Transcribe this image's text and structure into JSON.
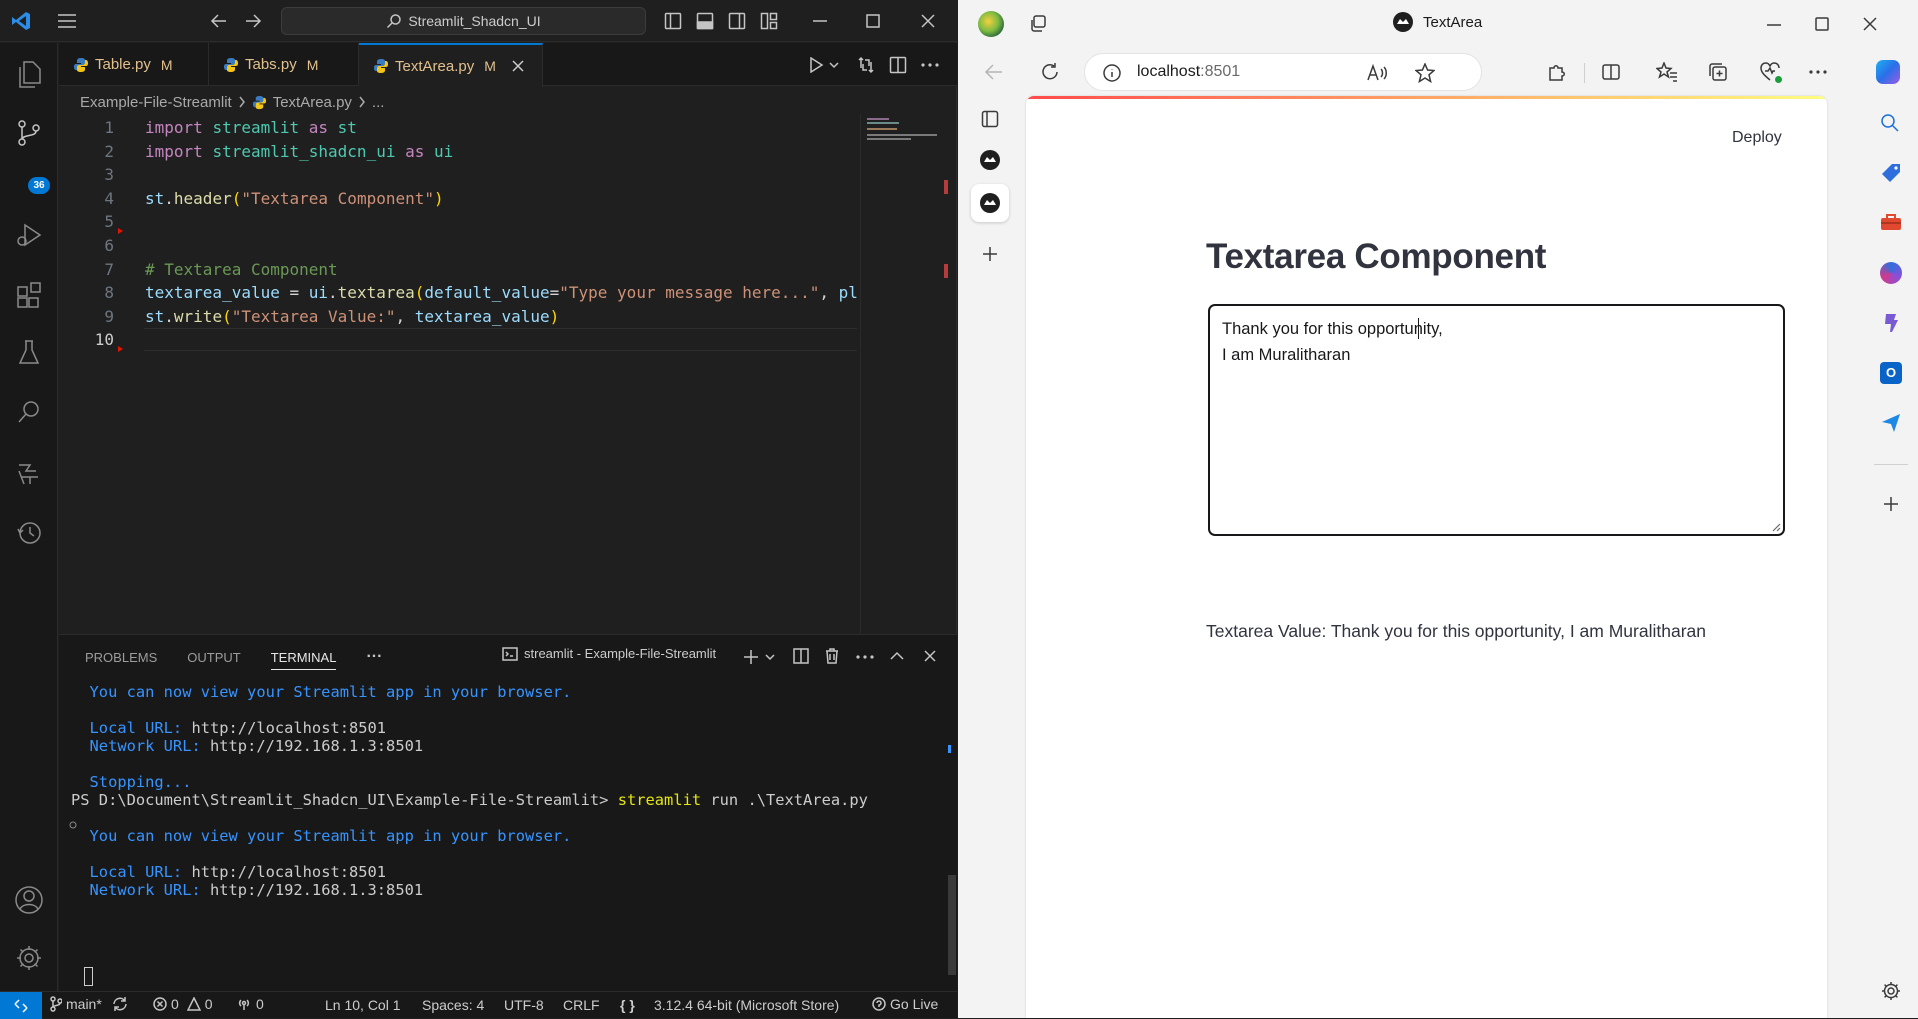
{
  "vscode": {
    "search": "Streamlit_Shadcn_UI",
    "activity": {
      "scm_badge": "36"
    },
    "tabs": [
      {
        "name": "Table.py",
        "status": "M"
      },
      {
        "name": "Tabs.py",
        "status": "M"
      },
      {
        "name": "TextArea.py",
        "status": "M"
      }
    ],
    "breadcrumb": {
      "folder": "Example-File-Streamlit",
      "file": "TextArea.py",
      "more": "..."
    },
    "code_lines": [
      [
        [
          "kw",
          "import "
        ],
        [
          "md",
          "streamlit"
        ],
        [
          "kw",
          " as "
        ],
        [
          "md",
          "st"
        ]
      ],
      [
        [
          "kw",
          "import "
        ],
        [
          "md",
          "streamlit_shadcn_ui"
        ],
        [
          "kw",
          " as "
        ],
        [
          "md",
          "ui"
        ]
      ],
      [],
      [
        [
          "vr",
          "st"
        ],
        [
          "pl",
          "."
        ],
        [
          "fn",
          "header"
        ],
        [
          "bc",
          "("
        ],
        [
          "st",
          "\"Textarea Component\""
        ],
        [
          "bc",
          ")"
        ]
      ],
      [],
      [],
      [
        [
          "cm",
          "# Textarea Component"
        ]
      ],
      [
        [
          "vr",
          "textarea_value"
        ],
        [
          "pl",
          " = "
        ],
        [
          "vr",
          "ui"
        ],
        [
          "pl",
          "."
        ],
        [
          "fn",
          "textarea"
        ],
        [
          "bc",
          "("
        ],
        [
          "vr",
          "default_value"
        ],
        [
          "pl",
          "="
        ],
        [
          "st",
          "\"Type your message here...\""
        ],
        [
          "pl",
          ", "
        ],
        [
          "vr",
          "pl"
        ]
      ],
      [
        [
          "vr",
          "st"
        ],
        [
          "pl",
          "."
        ],
        [
          "fn",
          "write"
        ],
        [
          "bc",
          "("
        ],
        [
          "st",
          "\"Textarea Value:\""
        ],
        [
          "pl",
          ", "
        ],
        [
          "vr",
          "textarea_value"
        ],
        [
          "bc",
          ")"
        ]
      ],
      []
    ],
    "line_numbers": [
      "1",
      "2",
      "3",
      "4",
      "5",
      "6",
      "7",
      "8",
      "9",
      "10"
    ],
    "panel": {
      "tabs": [
        "PROBLEMS",
        "OUTPUT",
        "TERMINAL"
      ],
      "more": "···",
      "terminal_name": "streamlit - Example-File-Streamlit"
    },
    "terminal_lines": [
      [
        [
          "tb",
          "  You can now view your Streamlit app in your browser."
        ]
      ],
      [],
      [
        [
          "tb",
          "  Local URL: "
        ],
        [
          "tw",
          "http://localhost:8501"
        ]
      ],
      [
        [
          "tb",
          "  Network URL: "
        ],
        [
          "tw",
          "http://192.168.1.3:8501"
        ]
      ],
      [],
      [
        [
          "tb",
          "  Stopping..."
        ]
      ],
      [
        [
          "tw",
          "PS D:\\Document\\Streamlit_Shadcn_UI\\Example-File-Streamlit> "
        ],
        [
          "ty",
          "streamlit"
        ],
        [
          "tw",
          " run .\\TextArea.py"
        ]
      ],
      [],
      [
        [
          "tb",
          "  You can now view your Streamlit app in your browser."
        ]
      ],
      [],
      [
        [
          "tb",
          "  Local URL: "
        ],
        [
          "tw",
          "http://localhost:8501"
        ]
      ],
      [
        [
          "tb",
          "  Network URL: "
        ],
        [
          "tw",
          "http://192.168.1.3:8501"
        ]
      ]
    ],
    "statusbar": {
      "branch": "main*",
      "errors": "0",
      "warnings": "0",
      "ports": "0",
      "position": "Ln 10, Col 1",
      "spaces": "Spaces: 4",
      "encoding": "UTF-8",
      "eol": "CRLF",
      "language": "{ }",
      "python": "3.12.4 64-bit (Microsoft Store)",
      "golive": "Go Live"
    }
  },
  "browser": {
    "tab_title": "TextArea",
    "url_host": "localhost",
    "url_port": ":8501",
    "deploy": "Deploy",
    "header": "Textarea Component",
    "textarea_value": "Thank you for this opportunity,\nI am Muralitharan",
    "output": "Textarea Value: Thank you for this opportunity, I am Muralitharan"
  },
  "colors": {
    "accent": "#0078d4",
    "vscode_bg": "#1f1f1f",
    "editor_bg": "#181818",
    "streamlit_red": "#ff4b4b"
  }
}
